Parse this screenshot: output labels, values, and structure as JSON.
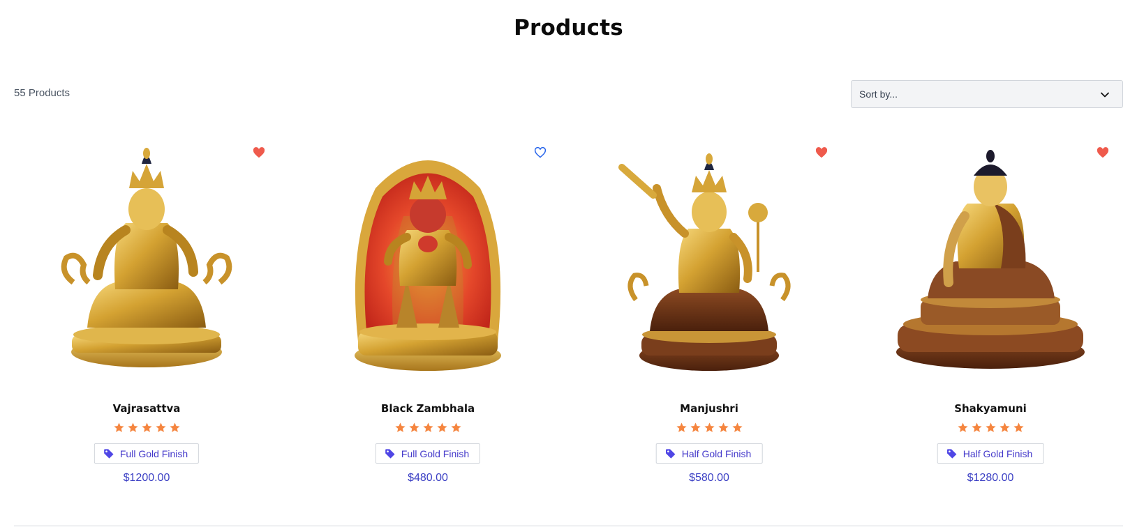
{
  "page": {
    "title": "Products"
  },
  "toolbar": {
    "count_label": "55 Products",
    "sort_placeholder": "Sort by..."
  },
  "colors": {
    "accent": "#3b3fc4",
    "heart_filled": "#ef5a4c",
    "heart_outline": "#2563eb",
    "star": "#f5853f",
    "tag": "#4f46e5"
  },
  "products": [
    {
      "name": "Vajrasattva",
      "rating": 5,
      "finish": "Full Gold Finish",
      "price": "$1200.00",
      "favorited": true,
      "icon": "vajrasattva-statue-image"
    },
    {
      "name": "Black Zambhala",
      "rating": 5,
      "finish": "Full Gold Finish",
      "price": "$480.00",
      "favorited": false,
      "icon": "black-zambhala-statue-image"
    },
    {
      "name": "Manjushri",
      "rating": 5,
      "finish": "Half Gold Finish",
      "price": "$580.00",
      "favorited": true,
      "icon": "manjushri-statue-image"
    },
    {
      "name": "Shakyamuni",
      "rating": 5,
      "finish": "Half Gold Finish",
      "price": "$1280.00",
      "favorited": true,
      "icon": "shakyamuni-statue-image"
    }
  ]
}
